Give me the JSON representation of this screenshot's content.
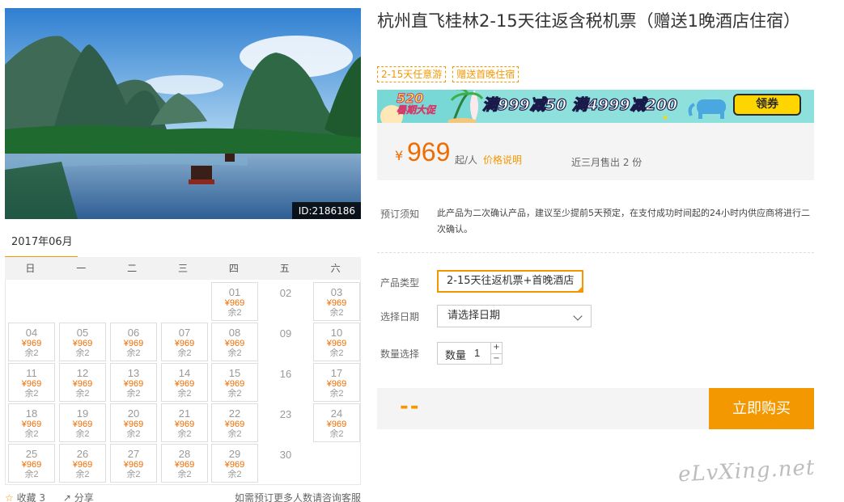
{
  "photo": {
    "id_label": "ID:2186186"
  },
  "product": {
    "title": "杭州直飞桂林2-15天往返含税机票（赠送1晚酒店住宿）",
    "tags": [
      "2-15天任意游",
      "赠送首晚住宿"
    ]
  },
  "banner": {
    "badge_top": "520",
    "badge_bottom": "暑期大促",
    "promo": "满999减50 满4999减200",
    "button": "领券"
  },
  "price": {
    "currency": "¥",
    "amount": "969",
    "unit": "起/人",
    "note": "价格说明",
    "sold": "近三月售出 2 份"
  },
  "booking": {
    "notice_label": "预订须知",
    "notice_text": "此产品为二次确认产品，建议至少提前5天预定，在支付成功时间起的24小时内供应商将进行二次确认。",
    "type_label": "产品类型",
    "type_value": "2-15天往返机票+首晚酒店",
    "date_label": "选择日期",
    "date_placeholder": "请选择日期",
    "qty_label": "数量选择",
    "qty_field_label": "数量",
    "qty_value": "1",
    "plus": "+",
    "minus": "−"
  },
  "purchase": {
    "total": "--",
    "buy_button": "立即购买"
  },
  "calendar": {
    "month": "2017年06月",
    "weekdays": [
      "日",
      "一",
      "二",
      "三",
      "四",
      "五",
      "六"
    ],
    "days": [
      {
        "day": "01",
        "price": "¥969",
        "stock": "余2"
      },
      {
        "day": "02"
      },
      {
        "day": "03",
        "price": "¥969",
        "stock": "余2"
      },
      {
        "day": "04",
        "price": "¥969",
        "stock": "余2"
      },
      {
        "day": "05",
        "price": "¥969",
        "stock": "余2"
      },
      {
        "day": "06",
        "price": "¥969",
        "stock": "余2"
      },
      {
        "day": "07",
        "price": "¥969",
        "stock": "余2"
      },
      {
        "day": "08",
        "price": "¥969",
        "stock": "余2"
      },
      {
        "day": "09"
      },
      {
        "day": "10",
        "price": "¥969",
        "stock": "余2"
      },
      {
        "day": "11",
        "price": "¥969",
        "stock": "余2"
      },
      {
        "day": "12",
        "price": "¥969",
        "stock": "余2"
      },
      {
        "day": "13",
        "price": "¥969",
        "stock": "余2"
      },
      {
        "day": "14",
        "price": "¥969",
        "stock": "余2"
      },
      {
        "day": "15",
        "price": "¥969",
        "stock": "余2"
      },
      {
        "day": "16"
      },
      {
        "day": "17",
        "price": "¥969",
        "stock": "余2"
      },
      {
        "day": "18",
        "price": "¥969",
        "stock": "余2"
      },
      {
        "day": "19",
        "price": "¥969",
        "stock": "余2"
      },
      {
        "day": "20",
        "price": "¥969",
        "stock": "余2"
      },
      {
        "day": "21",
        "price": "¥969",
        "stock": "余2"
      },
      {
        "day": "22",
        "price": "¥969",
        "stock": "余2"
      },
      {
        "day": "23"
      },
      {
        "day": "24",
        "price": "¥969",
        "stock": "余2"
      },
      {
        "day": "25",
        "price": "¥969",
        "stock": "余2"
      },
      {
        "day": "26",
        "price": "¥969",
        "stock": "余2"
      },
      {
        "day": "27",
        "price": "¥969",
        "stock": "余2"
      },
      {
        "day": "28",
        "price": "¥969",
        "stock": "余2"
      },
      {
        "day": "29",
        "price": "¥969",
        "stock": "余2"
      },
      {
        "day": "30"
      }
    ]
  },
  "footer": {
    "favorite": "收藏 3",
    "share": "分享",
    "contact": "如需预订更多人数请咨询客服"
  },
  "watermark": "eLvXing.net"
}
